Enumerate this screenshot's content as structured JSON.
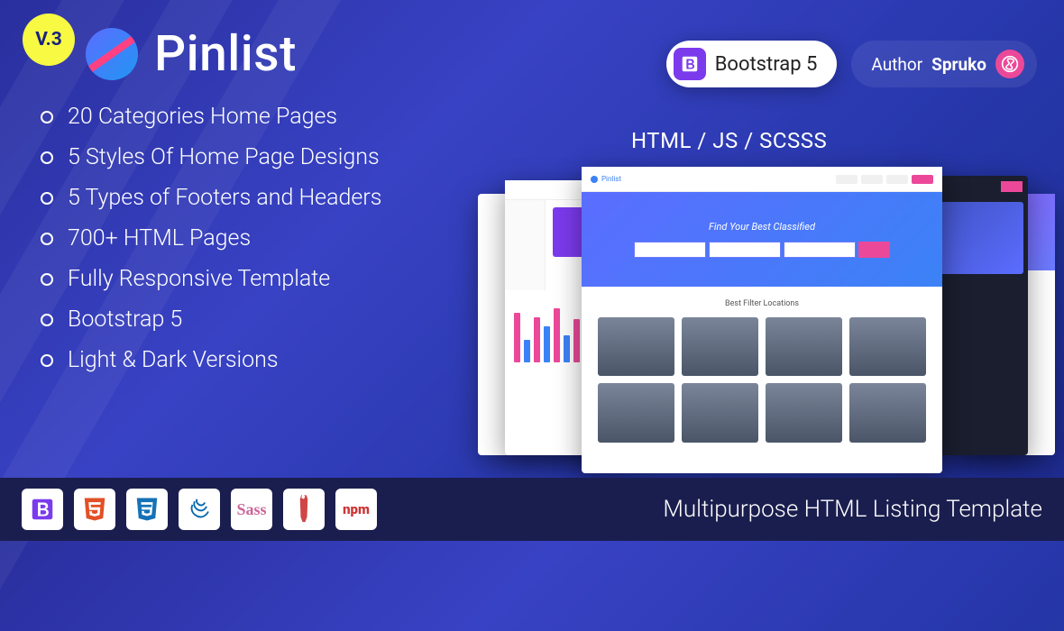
{
  "version_badge": "V.3",
  "product_name": "Pinlist",
  "bootstrap_pill": "Bootstrap 5",
  "author_label": "Author",
  "author_name": "Spruko",
  "tech_label": "HTML / JS / SCSSS",
  "features": [
    "20 Categories Home Pages",
    "5 Styles Of Home Page Designs",
    "5 Types of Footers and Headers",
    "700+ HTML Pages",
    "Fully Responsive Template",
    "Bootstrap 5",
    "Light  &  Dark Versions"
  ],
  "preview": {
    "logo_text": "Pinlist",
    "hero_title": "Find Your Best Classified",
    "section_title": "Best Filter Locations"
  },
  "footer_tagline": "Multipurpose HTML Listing  Template",
  "footer_icons": [
    "bootstrap",
    "html5",
    "css3",
    "jquery",
    "sass",
    "gulp",
    "npm"
  ]
}
